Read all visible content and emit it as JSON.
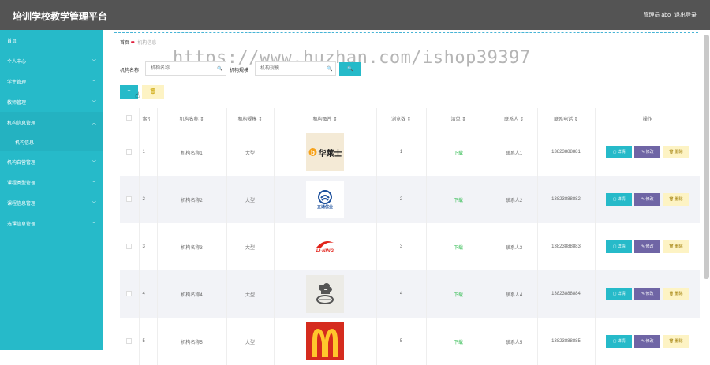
{
  "app": {
    "title": "培训学校教学管理平台",
    "user_label": "管理员 abo",
    "logout": "退出登录"
  },
  "sidebar": {
    "items": [
      {
        "label": "首页",
        "chevron": ""
      },
      {
        "label": "个人中心",
        "chevron": "﹀"
      },
      {
        "label": "学生管理",
        "chevron": "﹀"
      },
      {
        "label": "教师管理",
        "chevron": "﹀"
      },
      {
        "label": "机构信息管理",
        "chevron": "︿"
      },
      {
        "label": "机构信息",
        "chevron": ""
      },
      {
        "label": "机构自营管理",
        "chevron": "﹀"
      },
      {
        "label": "课程类型管理",
        "chevron": "﹀"
      },
      {
        "label": "课程信息管理",
        "chevron": "﹀"
      },
      {
        "label": "选课信息管理",
        "chevron": "﹀"
      }
    ]
  },
  "breadcrumb": {
    "home": "首页",
    "heart": "❤",
    "current": "机构信息"
  },
  "watermark": "https://www.huzhan.com/ishop39397",
  "search": {
    "name_label": "机构名称",
    "name_placeholder": "机构名称",
    "scale_label": "机构规模",
    "scale_placeholder": "机构规模",
    "button": "🔍",
    "mag": "🔍"
  },
  "toolbar": {
    "add": "+",
    "delete": "🗑"
  },
  "table": {
    "headers": [
      "",
      "索引",
      "机构名称 ⇕",
      "机构规模 ⇕",
      "机构图片 ⇕",
      "浏览数 ⇕",
      "清单 ⇕",
      "联系人 ⇕",
      "联系电话 ⇕",
      "操作"
    ],
    "rows": [
      {
        "index": "1",
        "name": "机构名称1",
        "scale": "大型",
        "logo": "huaqishi",
        "views": "1",
        "list": "下载",
        "contact": "联系人1",
        "phone": "13823888881"
      },
      {
        "index": "2",
        "name": "机构名称2",
        "scale": "大型",
        "logo": "lidu",
        "views": "2",
        "list": "下载",
        "contact": "联系人2",
        "phone": "13823888882"
      },
      {
        "index": "3",
        "name": "机构名称3",
        "scale": "大型",
        "logo": "lining",
        "views": "3",
        "list": "下载",
        "contact": "联系人3",
        "phone": "13823888883"
      },
      {
        "index": "4",
        "name": "机构名称4",
        "scale": "大型",
        "logo": "chef",
        "views": "4",
        "list": "下载",
        "contact": "联系人4",
        "phone": "13823888884"
      },
      {
        "index": "5",
        "name": "机构名称5",
        "scale": "大型",
        "logo": "mcdonalds",
        "views": "5",
        "list": "下载",
        "contact": "联系人5",
        "phone": "13823888885"
      }
    ],
    "actions": {
      "detail": "▢ 详情",
      "edit": "✎ 修改",
      "remove": "🗑 删除"
    }
  },
  "logo_text": {
    "huaqishi": "华莱士",
    "lidu": "立通优业",
    "lining": "LI-NING"
  },
  "colors": {
    "sidebar": "#26bac9",
    "topbar": "#545454",
    "accent": "#26bac9",
    "edit": "#6f65a5"
  }
}
